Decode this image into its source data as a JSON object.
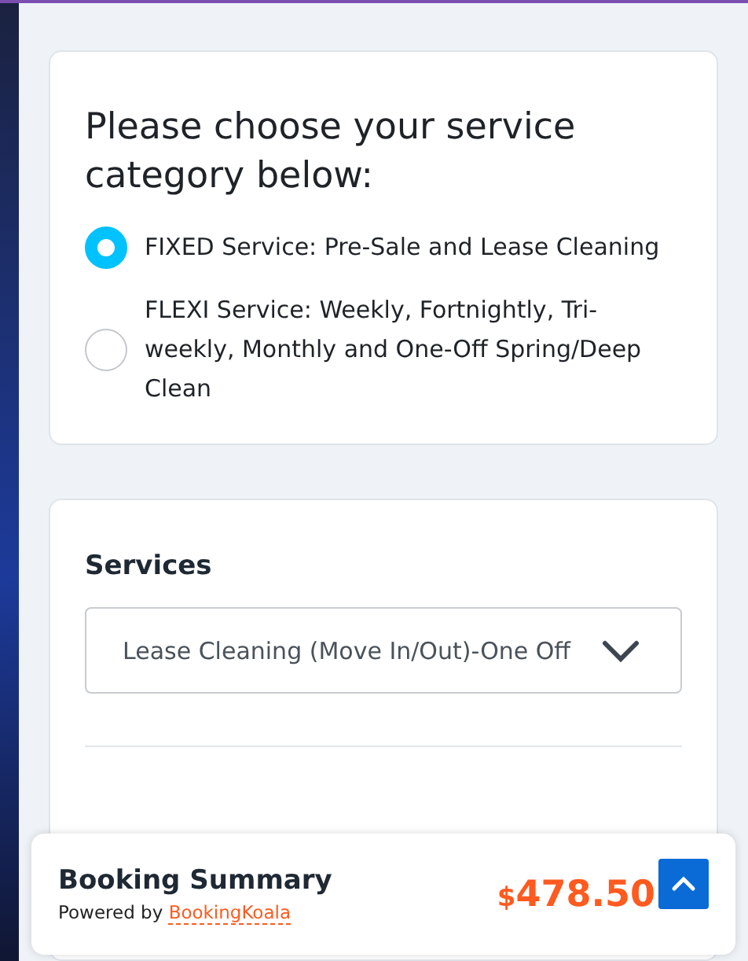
{
  "category": {
    "title": "Please choose your service category below:",
    "options": [
      {
        "label": "FIXED Service: Pre-Sale and Lease Cleaning",
        "selected": true
      },
      {
        "label": "FLEXI Service: Weekly, Fortnightly, Tri-weekly, Monthly and One-Off Spring/Deep Clean",
        "selected": false
      }
    ]
  },
  "services": {
    "label": "Services",
    "value": "Lease Cleaning (Move In/Out)-One Off"
  },
  "summary": {
    "title": "Booking Summary",
    "powered_by": "Powered by",
    "brand": "BookingKoala",
    "currency": "$",
    "amount": "478.50"
  }
}
